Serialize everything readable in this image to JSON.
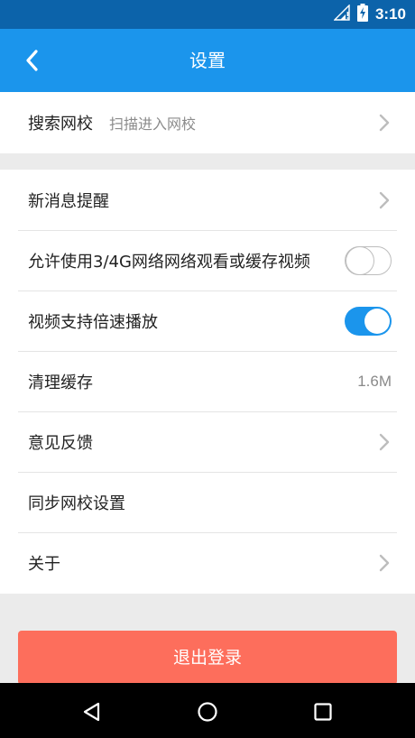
{
  "status_bar": {
    "time": "3:10"
  },
  "header": {
    "title": "设置"
  },
  "school": {
    "label": "搜索网校",
    "sub_label": "扫描进入网校"
  },
  "settings": {
    "new_message": {
      "label": "新消息提醒"
    },
    "network_cache": {
      "label": "允许使用3/4G网络网络观看或缓存视频",
      "enabled": false
    },
    "speed_play": {
      "label": "视频支持倍速播放",
      "enabled": true
    },
    "clear_cache": {
      "label": "清理缓存",
      "value": "1.6M"
    },
    "feedback": {
      "label": "意见反馈"
    },
    "sync_school": {
      "label": "同步网校设置"
    },
    "about": {
      "label": "关于"
    }
  },
  "logout": {
    "label": "退出登录"
  },
  "colors": {
    "accent": "#1b95ec",
    "status_bar": "#0c63aa",
    "logout": "#fd6e5c"
  },
  "icons": [
    "wifi-icon",
    "battery-charging-icon",
    "back-arrow-icon",
    "chevron-right-icon",
    "nav-back-icon",
    "nav-home-icon",
    "nav-recents-icon"
  ]
}
